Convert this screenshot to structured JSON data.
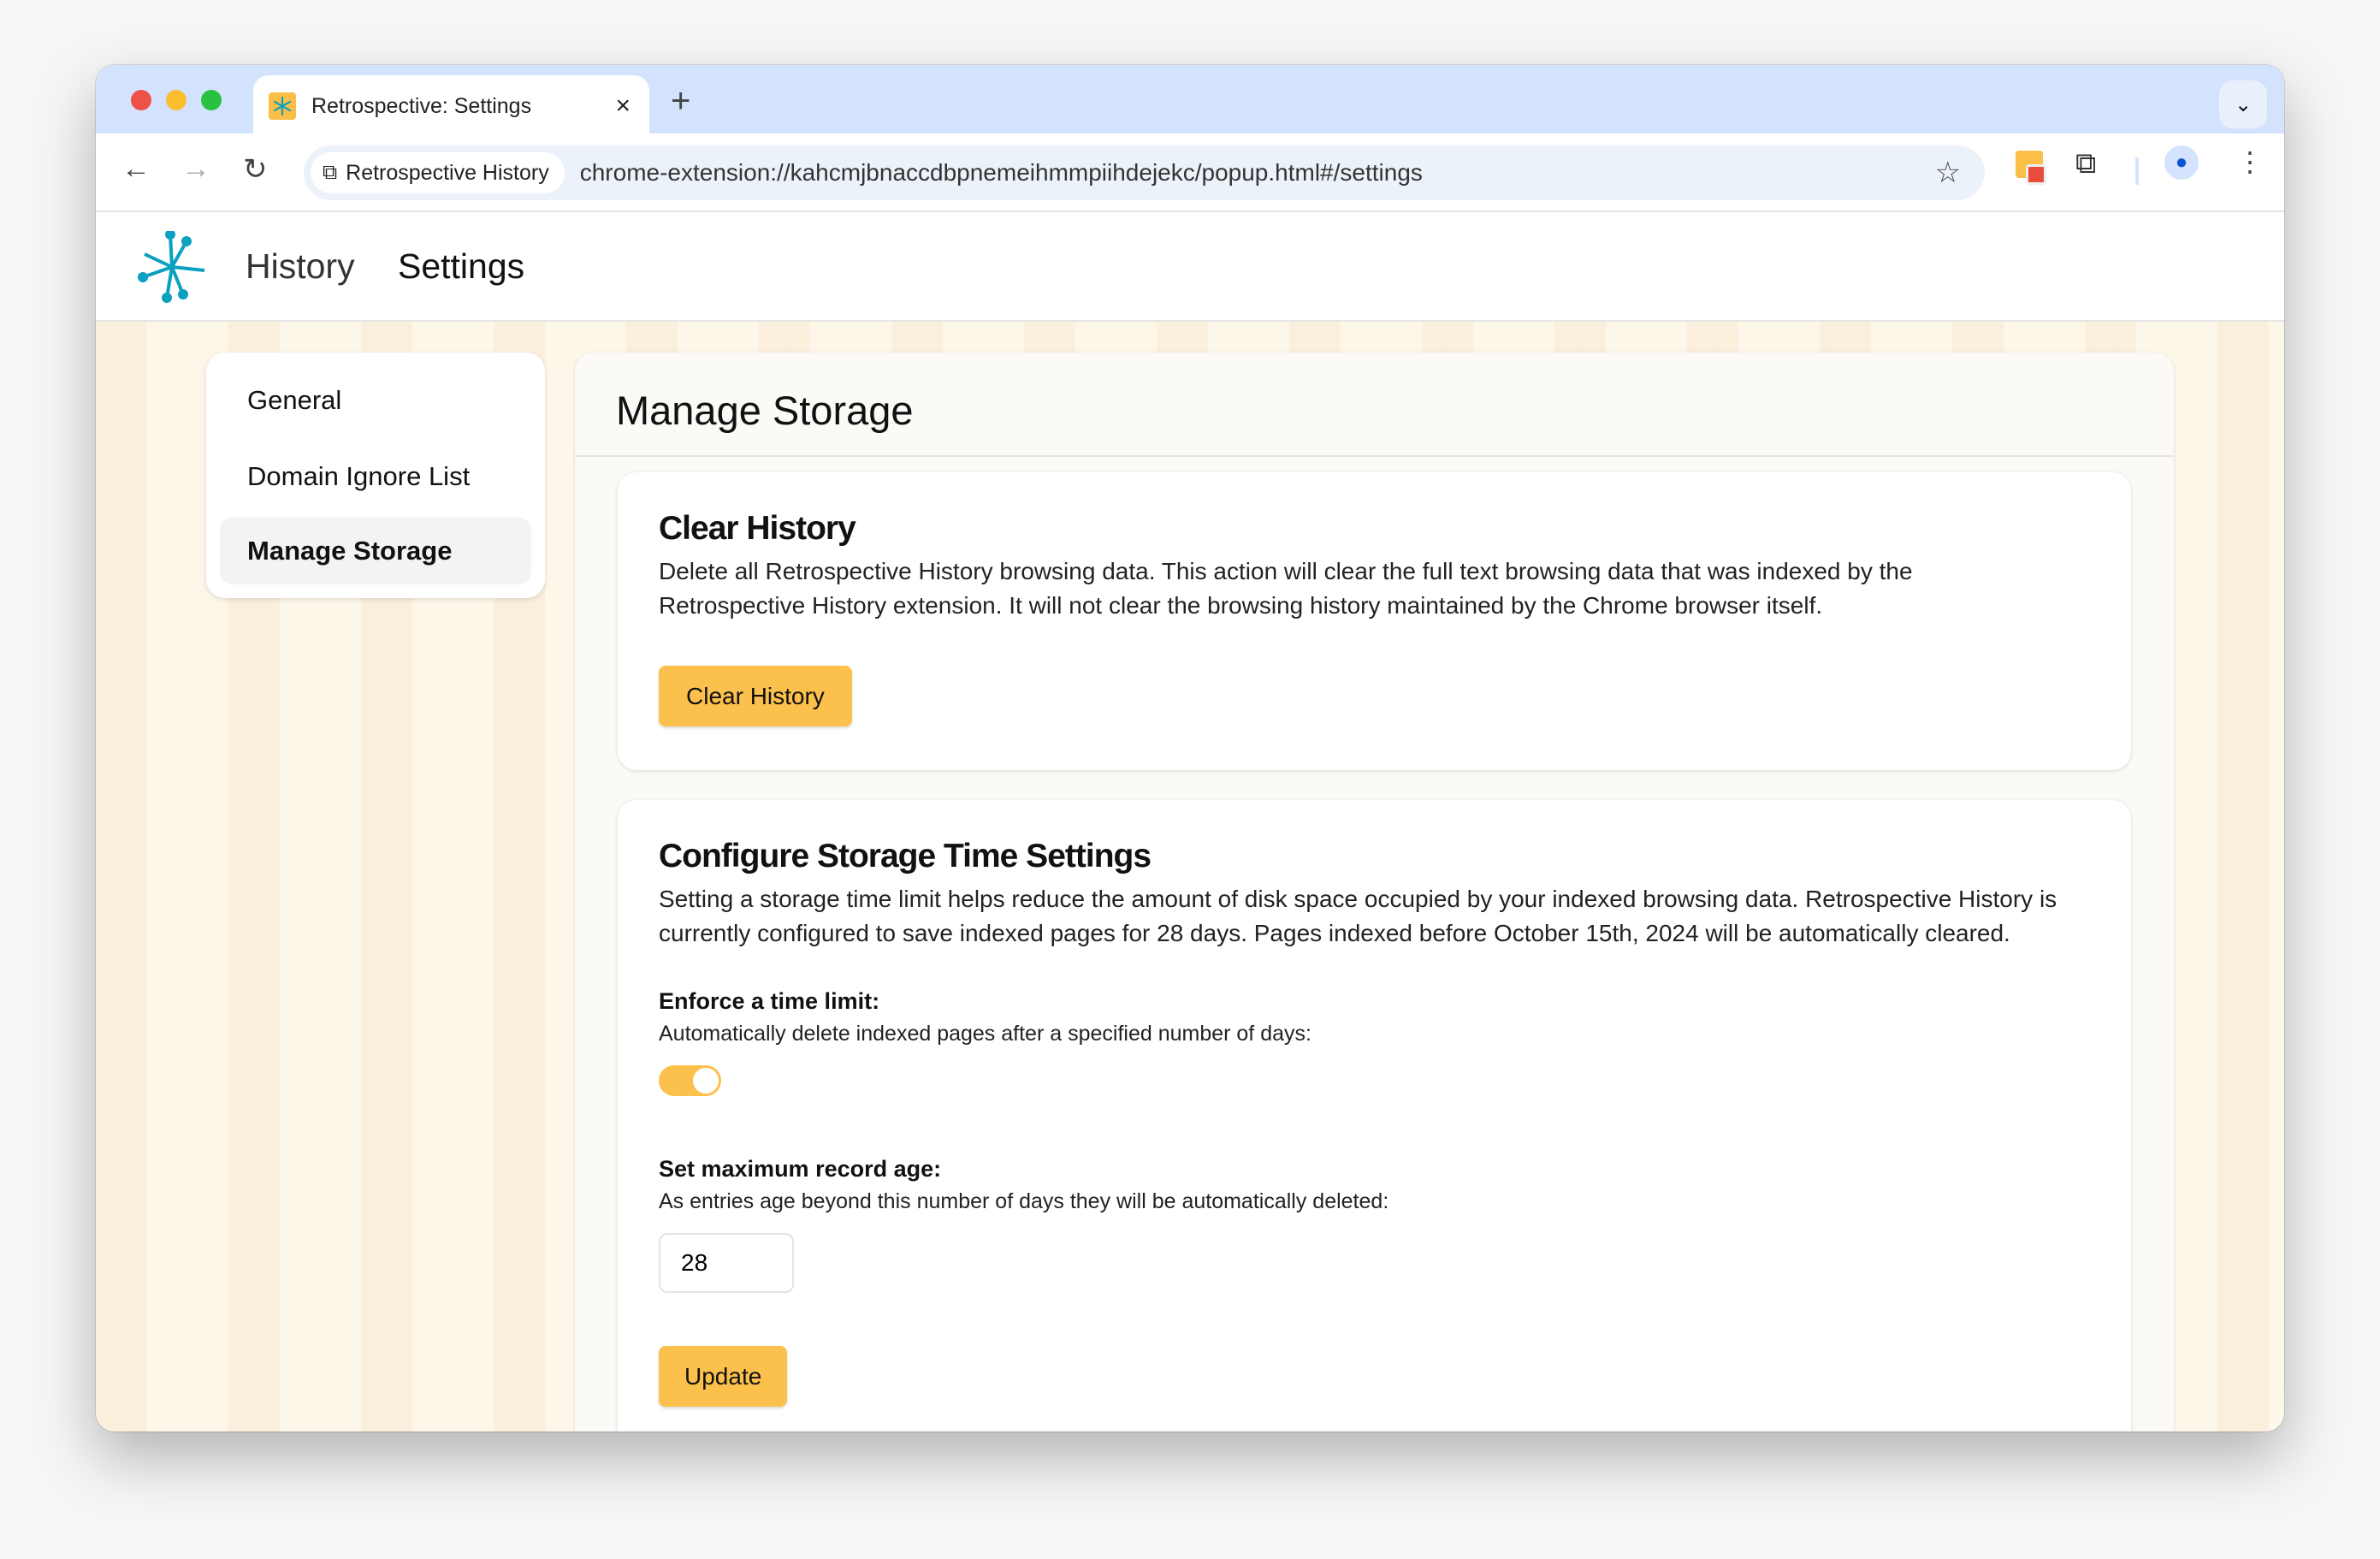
{
  "browser": {
    "tab_title": "Retrospective: Settings",
    "omnibox_chip": "Retrospective History",
    "url": "chrome-extension://kahcmjbnaccdbpnemeihmmpiihdejekc/popup.html#/settings",
    "icons": [
      "back-icon",
      "forward-icon",
      "reload-icon",
      "extension-puzzle-icon",
      "star-icon",
      "profile-icon",
      "more-icon",
      "chevron-down-icon"
    ]
  },
  "header": {
    "nav": [
      {
        "label": "History"
      },
      {
        "label": "Settings"
      }
    ]
  },
  "sidebar": {
    "items": [
      {
        "label": "General"
      },
      {
        "label": "Domain Ignore List"
      },
      {
        "label": "Manage Storage",
        "active": true
      }
    ]
  },
  "main": {
    "title": "Manage Storage",
    "clear": {
      "title": "Clear History",
      "text": "Delete all Retrospective History browsing data. This action will clear the full text browsing data that was indexed by the Retrospective History extension. It will not clear the browsing history maintained by the Chrome browser itself.",
      "button": "Clear History"
    },
    "configure": {
      "title": "Configure Storage Time Settings",
      "text": "Setting a storage time limit helps reduce the amount of disk space occupied by your indexed browsing data. Retrospective History is currently configured to save indexed pages for 28 days. Pages indexed before October 15th, 2024 will be automatically cleared.",
      "enforce_label": "Enforce a time limit:",
      "enforce_sub": "Automatically delete indexed pages after a specified number of days:",
      "enforce_on": true,
      "age_label": "Set maximum record age:",
      "age_sub": "As entries age beyond this number of days they will be automatically deleted:",
      "age_value": "28",
      "update_button": "Update"
    }
  },
  "colors": {
    "accent": "#fcc04c",
    "logo": "#0aa0c0",
    "tabbar": "#d3e3fd"
  }
}
